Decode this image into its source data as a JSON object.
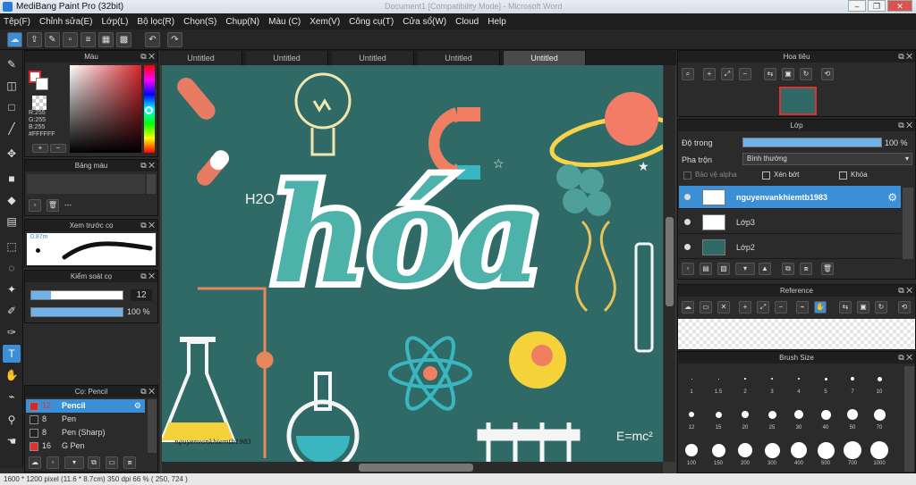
{
  "app": {
    "title": "MediBang Paint Pro (32bit)",
    "title_faded": "Document1 [Compatibility Mode] - Microsoft Word"
  },
  "menu": [
    "Tệp(F)",
    "Chỉnh sửa(E)",
    "Lớp(L)",
    "Bộ lọc(R)",
    "Chọn(S)",
    "Chụp(N)",
    "Màu (C)",
    "Xem(V)",
    "Công cụ(T)",
    "Cửa sổ(W)",
    "Cloud",
    "Help"
  ],
  "color_panel": {
    "title": "Màu",
    "r": "R:255",
    "g": "G:255",
    "b": "B:255",
    "hex": "#FFFFFF",
    "primary": "#d9262c",
    "secondary": "#ffffff"
  },
  "palette_panel": {
    "title": "Bảng màu",
    "text": "---"
  },
  "brush_preview": {
    "title": "Xem trước cọ",
    "size": "0.87m"
  },
  "brush_control": {
    "title": "Kiểm soát cọ",
    "size_value": "12",
    "opacity_value": "100 %"
  },
  "brush_list": {
    "title": "Cọ: Pencil",
    "items": [
      {
        "size": "12",
        "name": "Pencil",
        "color": "#d9262c",
        "selected": true
      },
      {
        "size": "8",
        "name": "Pen",
        "color": "#222222",
        "selected": false
      },
      {
        "size": "8",
        "name": "Pen (Sharp)",
        "color": "#222222",
        "selected": false
      },
      {
        "size": "16",
        "name": "G Pen",
        "color": "#e03030",
        "selected": false
      }
    ]
  },
  "tabs": [
    "Untitled",
    "Untitled",
    "Untitled",
    "Untitled",
    "Untitled"
  ],
  "canvas": {
    "word": "hóa",
    "formula1": "H2O",
    "formula2": "E=mc²",
    "signature": "nguyenvankhiemtb1983"
  },
  "navigator": {
    "title": "Hoa tiêu"
  },
  "layer_panel": {
    "title": "Lớp",
    "opacity_label": "Độ trong",
    "opacity_value": "100 %",
    "blend_label": "Pha trộn",
    "blend_value": "Bình thường",
    "protect_alpha": "Bảo vệ alpha",
    "clipping": "Xén bớt",
    "lock": "Khóa",
    "layers": [
      {
        "name": "nguyenvankhiemtb1983",
        "selected": true
      },
      {
        "name": "Lớp3",
        "selected": false
      },
      {
        "name": "Lớp2",
        "selected": false
      }
    ]
  },
  "reference": {
    "title": "Reference"
  },
  "brush_size": {
    "title": "Brush Size",
    "sizes": [
      "1",
      "1.5",
      "2",
      "3",
      "4",
      "5",
      "7",
      "10",
      "12",
      "15",
      "20",
      "25",
      "30",
      "40",
      "50",
      "70",
      "100",
      "150",
      "200",
      "300",
      "400",
      "500",
      "700",
      "1000"
    ]
  },
  "status": {
    "text": "1600 * 1200 pixel   (11.6 * 8.7cm)   350 dpi   66 %   ( 250, 724 )"
  }
}
